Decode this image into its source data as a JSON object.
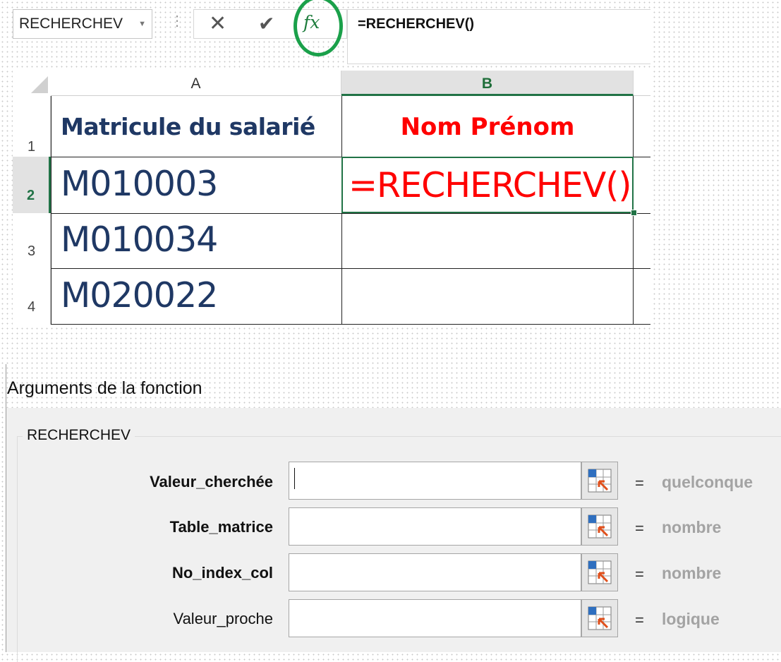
{
  "formula_bar": {
    "name_box": "RECHERCHEV",
    "cancel_icon": "close-icon",
    "enter_icon": "check-icon",
    "insert_function_label": "fx",
    "formula": "=RECHERCHEV()"
  },
  "grid": {
    "columns": [
      {
        "label": "A",
        "selected": false
      },
      {
        "label": "B",
        "selected": true
      }
    ],
    "row_labels": [
      "1",
      "2",
      "3",
      "4"
    ],
    "selected_row": "2",
    "header": {
      "a": "Matricule du salarié",
      "b": "Nom Prénom"
    },
    "rows": [
      {
        "a": "M010003",
        "b": "=RECHERCHEV()"
      },
      {
        "a": "M010034",
        "b": ""
      },
      {
        "a": "M020022",
        "b": ""
      }
    ]
  },
  "dialog": {
    "title": "Arguments de la fonction",
    "function_name": "RECHERCHEV",
    "arguments": [
      {
        "name": "Valeur_cherchée",
        "required": true,
        "value": "",
        "result": "quelconque"
      },
      {
        "name": "Table_matrice",
        "required": true,
        "value": "",
        "result": "nombre"
      },
      {
        "name": "No_index_col",
        "required": true,
        "value": "",
        "result": "nombre"
      },
      {
        "name": "Valeur_proche",
        "required": false,
        "value": "",
        "result": "logique"
      }
    ],
    "equals_sign": "="
  },
  "colors": {
    "excel_green": "#217346",
    "highlight_ring": "#1aa04a",
    "header_blue": "#1f3864",
    "accent_red": "#ff0000",
    "muted_result": "#a3a3a3"
  }
}
